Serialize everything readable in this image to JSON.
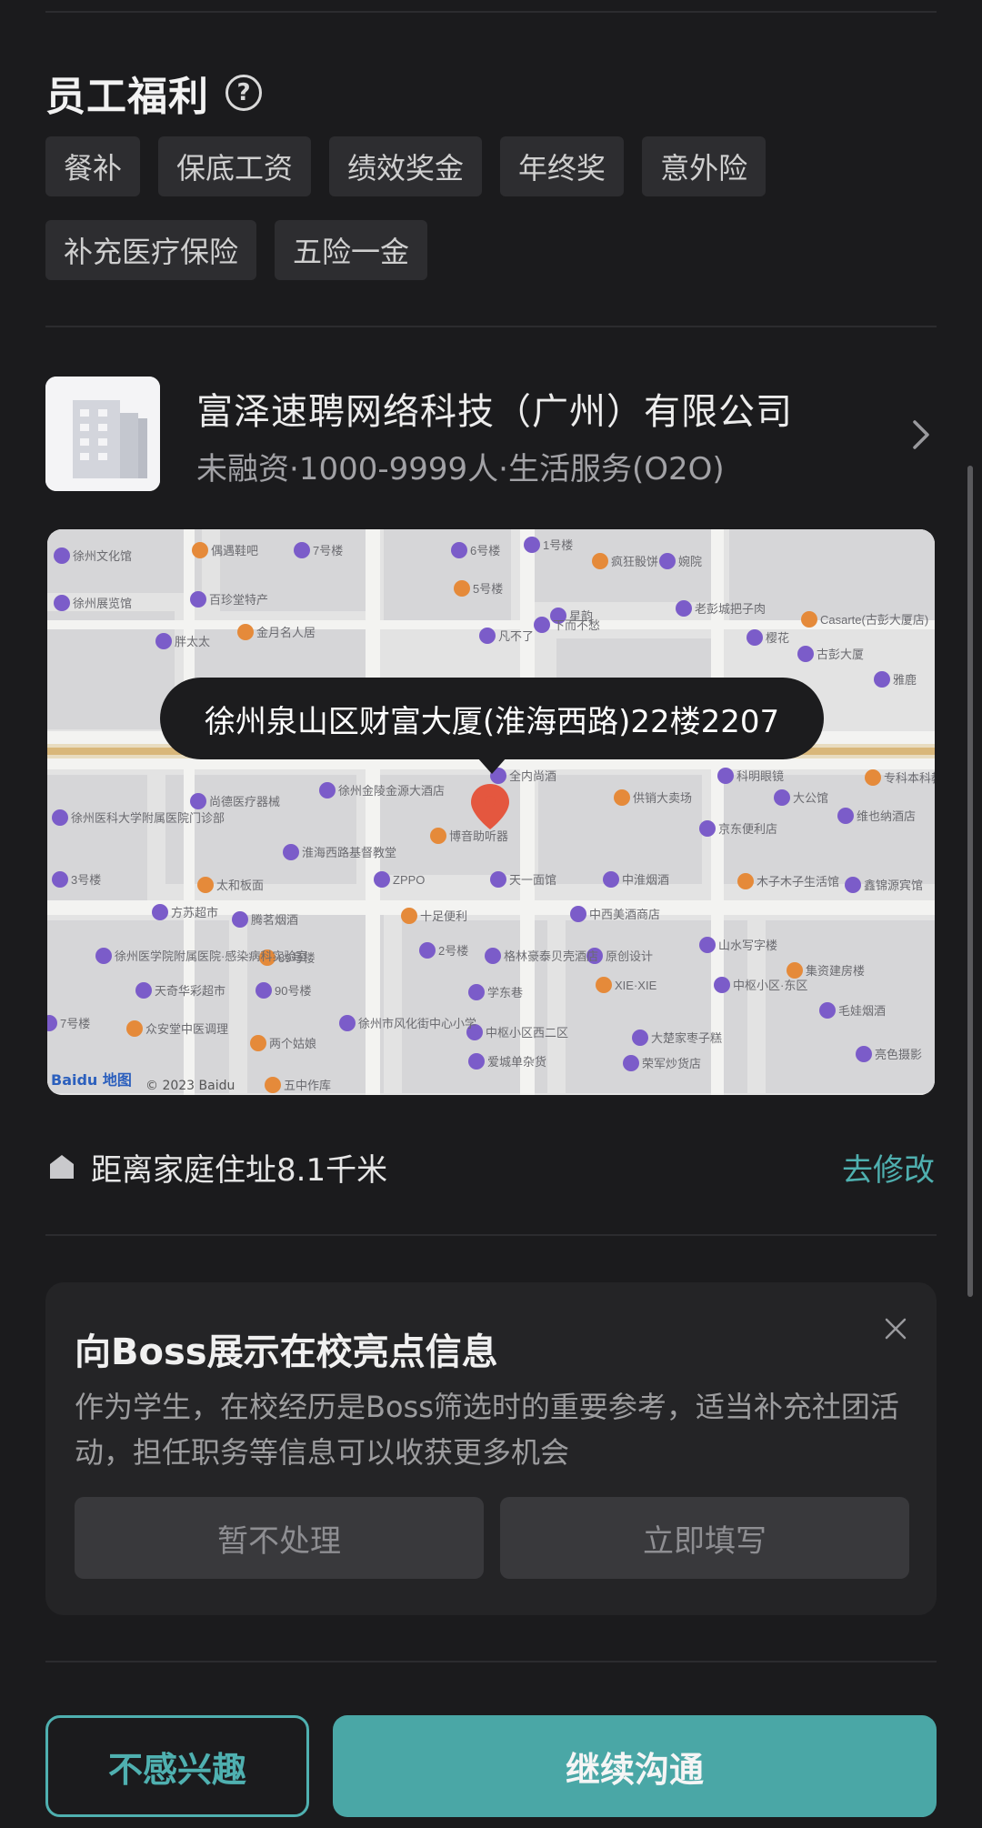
{
  "benefits": {
    "title": "员工福利",
    "tags": [
      "餐补",
      "保底工资",
      "绩效奖金",
      "年终奖",
      "意外险",
      "补充医疗保险",
      "五险一金"
    ]
  },
  "company": {
    "name": "富泽速聘网络科技（广州）有限公司",
    "meta": "未融资·1000-9999人·生活服务(O2O)"
  },
  "map": {
    "address": "徐州泉山区财富大厦(淮海西路)22楼2207",
    "attribution": "© 2023 Baidu",
    "logo": "Baidu 地图",
    "labels": [
      "徐州文化馆",
      "偶遇鞋吧",
      "7号楼",
      "6号楼",
      "1号楼",
      "疯狂骰饼",
      "婉院",
      "徐州展览馆",
      "百珍堂特产",
      "5号楼",
      "星韵",
      "老彭城把子肉",
      "胖太太",
      "金月名人居",
      "凡不了",
      "下而不愁",
      "樱花",
      "Casarte(古彭大厦店)",
      "古彭大厦",
      "雅鹿",
      "科明眼镜",
      "专科本科教育",
      "尚德医疗器械",
      "徐州金陵金源大酒店",
      "全内尚酒",
      "供销大卖场",
      "大公馆",
      "徐州医科大学附属医院门诊部",
      "淮海西路基督教堂",
      "博音助听器",
      "京东便利店",
      "维也纳酒店",
      "3号楼",
      "太和板面",
      "ZPPO",
      "天一面馆",
      "中淮烟酒",
      "木子木子生活馆",
      "鑫锦源宾馆",
      "方苏超市",
      "腾茗烟酒",
      "十足便利",
      "中西美酒商店",
      "山水写字楼",
      "徐州医学院附属医院·感染病科实验室",
      "89号楼",
      "2号楼",
      "格林豪泰贝壳酒店",
      "原创设计",
      "集资建房楼",
      "天奇华彩超市",
      "90号楼",
      "学东巷",
      "XIE·XIE",
      "中枢小区·东区",
      "毛娃烟酒",
      "7号楼",
      "众安堂中医调理",
      "徐州市风化街中心小学",
      "中枢小区西二区",
      "大楚家枣子糕",
      "两个姑娘",
      "爱城单杂货",
      "荣军炒货店",
      "亮色摄影",
      "五中作库"
    ]
  },
  "distance": {
    "label": "距离家庭住址8.1千米",
    "edit": "去修改"
  },
  "card": {
    "title": "向Boss展示在校亮点信息",
    "desc": "作为学生，在校经历是Boss筛选时的重要参考，适当补充社团活动，担任职务等信息可以收获更多机会",
    "btn_skip": "暂不处理",
    "btn_fill": "立即填写"
  },
  "actions": {
    "not_interested": "不感兴趣",
    "continue": "继续沟通"
  },
  "colors": {
    "accent": "#4fb0b0",
    "background": "#1b1b1d",
    "card": "#242426"
  }
}
